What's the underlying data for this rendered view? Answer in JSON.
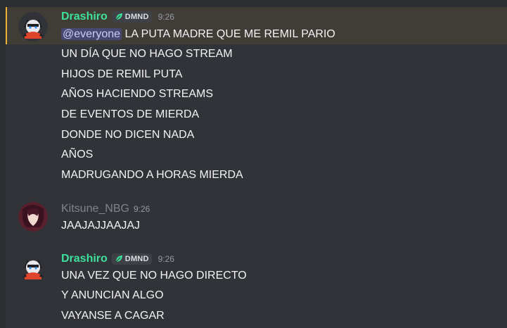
{
  "colors": {
    "background": "#313338",
    "username_green": "#3ee19b",
    "username_grey": "#80848e",
    "mention_bar": "#f0b232",
    "mention_pill": "#c9cdfb"
  },
  "messages": [
    {
      "author": "Drashiro",
      "tag": "DMND",
      "time": "9:26",
      "mention": "@everyone",
      "lines": [
        " LA PUTA MADRE QUE ME REMIL PARIO",
        "UN DÍA QUE NO HAGO STREAM",
        "HIJOS DE REMIL PUTA",
        "AÑOS HACIENDO STREAMS",
        "DE EVENTOS DE MIERDA",
        "DONDE NO DICEN NADA",
        "AÑOS",
        "MADRUGANDO A HORAS MIERDA"
      ]
    },
    {
      "author": "Kitsune_NBG",
      "time": "9:26",
      "lines": [
        "JAAJAJJAAJAJ"
      ]
    },
    {
      "author": "Drashiro",
      "tag": "DMND",
      "time": "9:26",
      "lines": [
        "UNA VEZ QUE NO HAGO DIRECTO",
        "Y ANUNCIAN ALGO",
        "VAYANSE A CAGAR"
      ]
    }
  ]
}
